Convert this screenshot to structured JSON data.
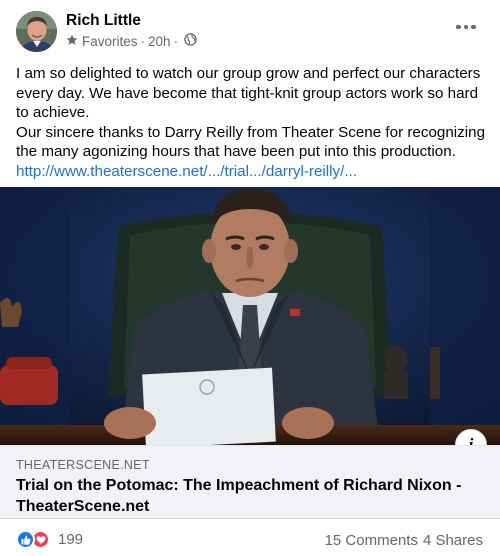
{
  "author": {
    "name": "Rich Little",
    "audience": "Favorites",
    "time": "20h"
  },
  "message": {
    "paragraph1": "I am so delighted to watch our group grow and perfect our characters every day. We have become that tight-knit group actors work so hard to achieve.",
    "paragraph2": "Our sincere thanks to Darry Reilly from Theater Scene for recognizing the many agonizing hours that have been put into this production.",
    "link": "http://www.theaterscene.net/.../trial.../darryl-reilly/..."
  },
  "link_preview": {
    "domain": "THEATERSCENE.NET",
    "title": "Trial on the Potomac: The Impeachment of Richard Nixon - TheaterScene.net"
  },
  "engagement": {
    "reactions": "199",
    "comments": "15 Comments",
    "shares": "4 Shares"
  },
  "icons": {
    "audience": "star-icon",
    "privacy": "globe-icon",
    "more": "more-options-icon",
    "info": "info-icon",
    "reactions": [
      "like-reaction-icon",
      "love-reaction-icon"
    ]
  },
  "colors": {
    "link": "#216fdb",
    "secondary_text": "#65676b",
    "like_blue": "#1877f2",
    "love_red": "#f33e58",
    "preview_background": "#f0f2f5"
  }
}
